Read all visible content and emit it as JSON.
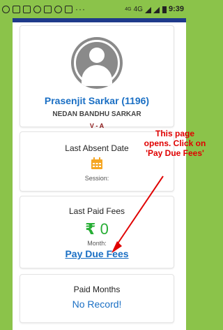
{
  "status_bar": {
    "icons": [
      "whatsapp-icon",
      "message-icon",
      "calendar-icon",
      "facebook-icon",
      "missed-call-icon",
      "facebook-icon",
      "youtube-icon"
    ],
    "more": "···",
    "network_vo": "4G",
    "network": "4G",
    "time": "9:39"
  },
  "profile": {
    "name": "Prasenjit Sarkar (1196)",
    "father": "NEDAN BANDHU SARKAR",
    "class": "V - A"
  },
  "last_absent": {
    "title": "Last Absent Date",
    "session_label": "Session:",
    "icon": "calendar-icon",
    "icon_color": "#f5a623"
  },
  "last_paid": {
    "title": "Last Paid Fees",
    "currency": "₹",
    "amount": "0",
    "month_label": "Month:",
    "link": "Pay Due Fees",
    "color": "#27ae35"
  },
  "paid_months": {
    "title": "Paid Months",
    "value": "No Record!"
  },
  "annotation": {
    "text": "This page opens. Click on 'Pay Due Fees'",
    "color": "#e00000"
  },
  "colors": {
    "accent_blue": "#1a6fc4",
    "frame_green": "#8bc34a",
    "header_navy": "#1e3a8a"
  }
}
